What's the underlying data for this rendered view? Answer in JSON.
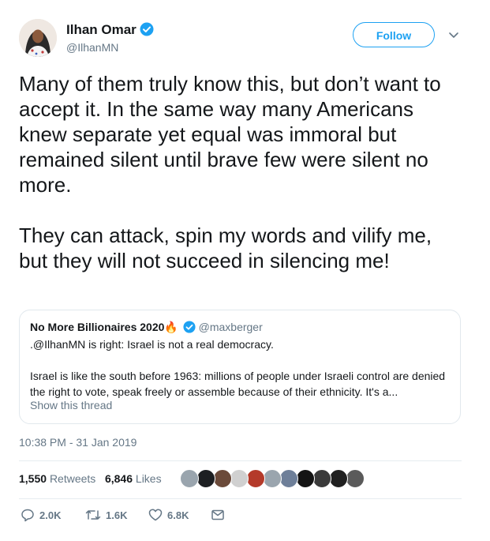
{
  "author": {
    "name": "Ilhan Omar",
    "handle": "@IlhanMN",
    "verified_color": "#1da1f2"
  },
  "follow_label": "Follow",
  "tweet_text": "Many of them truly know this, but don’t want to accept it. In the same way many Americans knew separate yet equal was immoral but remained silent until brave few were silent no more.\n\nThey can attack, spin my words and vilify me, but they will not succeed in silencing me!",
  "quoted": {
    "name": "No More Billionaires 2020",
    "emoji": "🔥",
    "handle": "@maxberger",
    "text": ".@IlhanMN is right: Israel is not a real democracy.\n\nIsrael is like the south before 1963: millions of people under Israeli control are denied the right to vote, speak freely or assemble because of their ethnicity. It's a...",
    "thread_link": "Show this thread"
  },
  "timestamp": "10:38 PM - 31 Jan 2019",
  "stats": {
    "retweets_count": "1,550",
    "retweets_label": "Retweets",
    "likes_count": "6,846",
    "likes_label": "Likes"
  },
  "liker_faces": [
    "#9aa5ae",
    "#1d1f22",
    "#6b4a3a",
    "#d0d0d0",
    "#b43a2a",
    "#9aa5ae",
    "#6e7f99",
    "#141414",
    "#3a3a3a",
    "#202020",
    "#5a5a5a"
  ],
  "actions": {
    "reply_count": "2.0K",
    "retweet_count": "1.6K",
    "like_count": "6.8K"
  },
  "colors": {
    "accent": "#1da1f2",
    "muted": "#657786",
    "text": "#14171a"
  }
}
